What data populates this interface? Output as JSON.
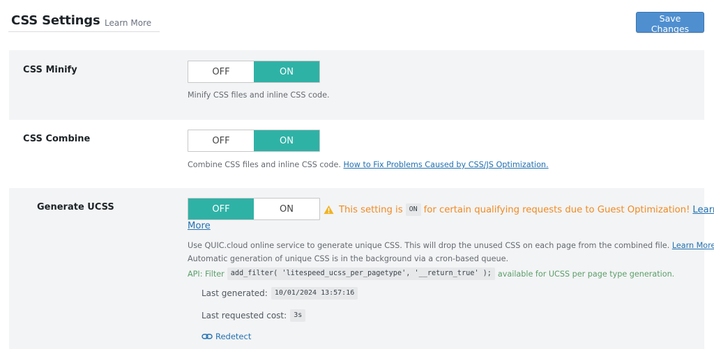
{
  "header": {
    "title": "CSS Settings",
    "learn_more": "Learn More",
    "save_label": "Save Changes"
  },
  "toggle_labels": {
    "off": "OFF",
    "on": "ON"
  },
  "rows": [
    {
      "label": "CSS Minify",
      "state": "ON",
      "description": "Minify CSS files and inline CSS code."
    },
    {
      "label": "CSS Combine",
      "state": "ON",
      "description": "Combine CSS files and inline CSS code.",
      "description_link": "How to Fix Problems Caused by CSS/JS Optimization."
    },
    {
      "label": "Generate UCSS",
      "state": "OFF",
      "warning": {
        "before": "This setting is",
        "chip": "ON",
        "after": "for certain qualifying requests due to Guest Optimization!",
        "learn": "Learn",
        "more": "More"
      },
      "description_1": "Use QUIC.cloud online service to generate unique CSS. This will drop the unused CSS on each page from the combined file.",
      "description_1_link": "Learn More",
      "description_2": "Automatic generation of unique CSS is in the background via a cron-based queue.",
      "api": {
        "prefix": "API: Filter",
        "code": "add_filter( 'litespeed_ucss_per_pagetype', '__return_true' );",
        "suffix": "available for UCSS per page type generation."
      },
      "last_generated": {
        "label": "Last generated:",
        "value": "10/01/2024 13:57:16"
      },
      "last_cost": {
        "label": "Last requested cost:",
        "value": "3s"
      },
      "redetect": "Redetect"
    }
  ],
  "colors": {
    "accent": "#2fb2a6",
    "button": "#4f8fd0",
    "warning": "#f08a24",
    "link": "#2271b1",
    "api_text": "#5a9e6a"
  },
  "icons": {
    "warning": "warning-triangle-icon",
    "redetect": "link-icon"
  }
}
